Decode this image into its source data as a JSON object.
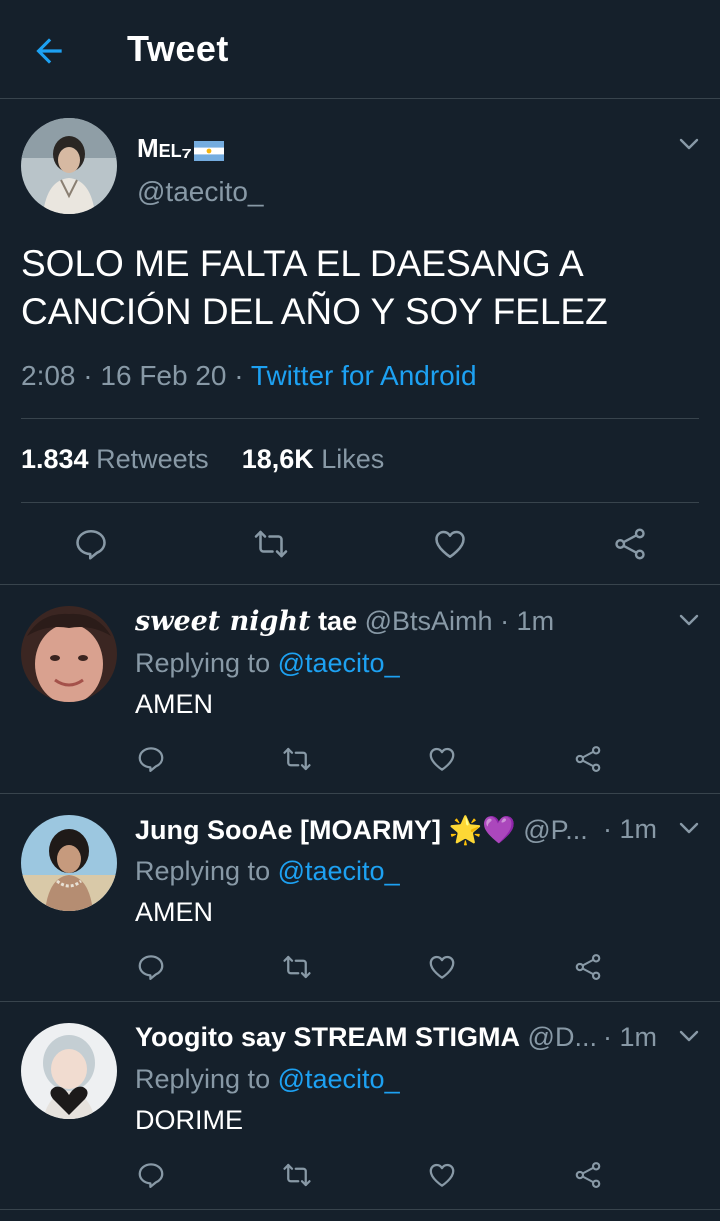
{
  "header": {
    "title": "Tweet"
  },
  "main_tweet": {
    "name_text": "Mel₇",
    "handle": "@taecito_",
    "text": "SOLO ME FALTA EL DAESANG A CANCIÓN DEL AÑO Y SOY FELEZ",
    "time": "2:08",
    "date": "16 Feb 20",
    "source": "Twitter for Android",
    "retweet_count": "1.834",
    "retweet_label": "Retweets",
    "like_count": "18,6K",
    "like_label": "Likes"
  },
  "replies": [
    {
      "name": "sweet night",
      "name2": "tae",
      "handle": "@BtsAimh",
      "time": "· 1m",
      "replying_label": "Replying to",
      "replying_to": "@taecito_",
      "text": "AMEN"
    },
    {
      "name": "Jung SooAe [MOARMY]",
      "emoji": "🌟💜",
      "handle": "@P...",
      "time": "· 1m",
      "replying_label": "Replying to",
      "replying_to": "@taecito_",
      "text": "AMEN"
    },
    {
      "name": "Yoogito say STREAM STIGMA",
      "handle": "@D...",
      "time": "· 1m",
      "replying_label": "Replying to",
      "replying_to": "@taecito_",
      "text": "DORIME"
    }
  ],
  "colors": {
    "background": "#15202b",
    "accent": "#1da1f2",
    "muted": "#8899a6",
    "divider": "#38444d"
  },
  "icons": [
    "back-arrow-icon",
    "chevron-down-icon",
    "reply-icon",
    "retweet-icon",
    "like-icon",
    "share-icon"
  ]
}
